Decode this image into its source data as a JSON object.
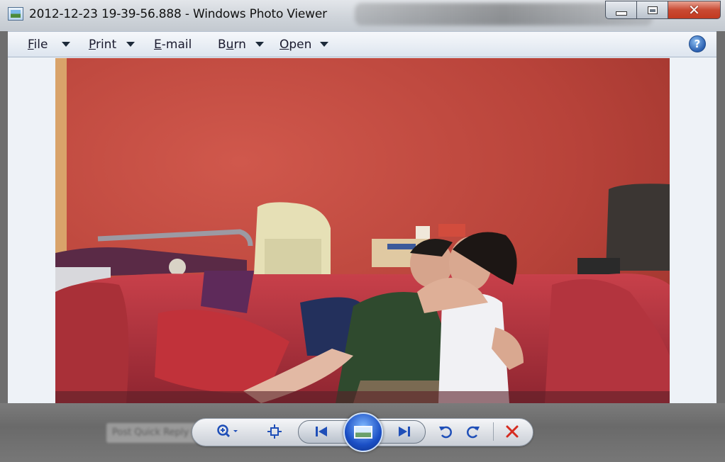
{
  "window": {
    "title": "2012-12-23 19-39-56.888 - Windows Photo Viewer"
  },
  "caption": {
    "minimize_label": "minimize",
    "maximize_label": "maximize",
    "close_label": "close"
  },
  "menu": {
    "items": [
      {
        "label": "File",
        "accel": "F",
        "rest": "ile"
      },
      {
        "label": "Print",
        "accel": "P",
        "rest": "rint"
      },
      {
        "label": "E-mail",
        "accel": "E",
        "rest": "-mail"
      },
      {
        "label": "Burn",
        "accel": "u",
        "pre": "B",
        "rest": "rn"
      },
      {
        "label": "Open",
        "accel": "O",
        "rest": "pen"
      }
    ],
    "help_glyph": "?"
  },
  "toolbar": {
    "ghost_text": "Post Quick Reply   Go Advanced",
    "icons": [
      "zoom-icon",
      "fit-to-window-icon",
      "previous-icon",
      "slideshow-icon",
      "next-icon",
      "rotate-counterclockwise-icon",
      "rotate-clockwise-icon",
      "delete-icon"
    ],
    "accent": "#1b4fc5",
    "delete_color": "#d62b1f"
  }
}
